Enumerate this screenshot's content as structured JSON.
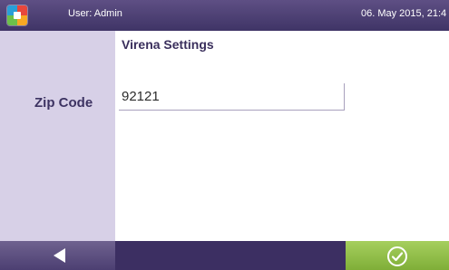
{
  "topbar": {
    "logo_icon": "app-logo-icon",
    "user": "User: Admin",
    "datetime": "06. May 2015, 21:4"
  },
  "page": {
    "title": "Virena Settings"
  },
  "form": {
    "zip_label": "Zip Code",
    "zip_value": "92121"
  },
  "bottombar": {
    "back_icon": "back-arrow-icon",
    "confirm_icon": "check-circle-icon"
  },
  "colors": {
    "header": "#4a3e70",
    "sidebar": "#d7d0e7",
    "confirm": "#8fbe45",
    "label": "#3d3362"
  }
}
